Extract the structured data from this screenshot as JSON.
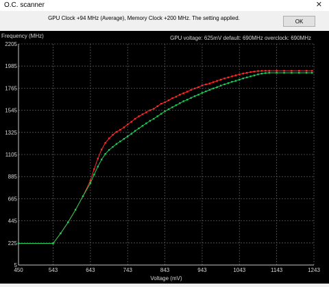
{
  "window": {
    "title": "O.C. scanner",
    "close_glyph": "✕"
  },
  "status_text": "GPU Clock +94 MHz (Average), Memory Clock +200 MHz. The setting applied.",
  "ok_label": "OK",
  "chart_data": {
    "type": "line",
    "ylabel": "Frequency (MHz)",
    "xlabel": "Voltage (mV)",
    "header_note": "GPU voltage: 625mV default: 690MHz overclock: 690MHz",
    "x_ticks": [
      450,
      543,
      643,
      743,
      843,
      943,
      1043,
      1143,
      1243
    ],
    "y_ticks": [
      5,
      225,
      445,
      665,
      885,
      1105,
      1325,
      1545,
      1765,
      1985,
      2205
    ],
    "xlim": [
      450,
      1243
    ],
    "ylim": [
      5,
      2205
    ],
    "grid": true,
    "colors": {
      "red": "#ff2a2a",
      "green": "#1cd05a",
      "grid": "#5a5a5a",
      "axis": "#c8c8c8",
      "text": "#d8d8d8"
    },
    "series": [
      {
        "color": "red",
        "points": [
          [
            450,
            220
          ],
          [
            543,
            220
          ],
          [
            563,
            320
          ],
          [
            583,
            430
          ],
          [
            603,
            555
          ],
          [
            623,
            690
          ],
          [
            643,
            845
          ],
          [
            653,
            960
          ],
          [
            663,
            1065
          ],
          [
            673,
            1155
          ],
          [
            683,
            1220
          ],
          [
            693,
            1265
          ],
          [
            703,
            1300
          ],
          [
            713,
            1330
          ],
          [
            723,
            1350
          ],
          [
            733,
            1375
          ],
          [
            743,
            1405
          ],
          [
            753,
            1430
          ],
          [
            763,
            1460
          ],
          [
            773,
            1485
          ],
          [
            783,
            1505
          ],
          [
            793,
            1525
          ],
          [
            803,
            1545
          ],
          [
            813,
            1560
          ],
          [
            823,
            1585
          ],
          [
            833,
            1610
          ],
          [
            843,
            1625
          ],
          [
            853,
            1645
          ],
          [
            863,
            1665
          ],
          [
            873,
            1680
          ],
          [
            883,
            1700
          ],
          [
            893,
            1715
          ],
          [
            903,
            1730
          ],
          [
            913,
            1748
          ],
          [
            923,
            1762
          ],
          [
            933,
            1775
          ],
          [
            943,
            1792
          ],
          [
            953,
            1802
          ],
          [
            963,
            1812
          ],
          [
            973,
            1825
          ],
          [
            983,
            1838
          ],
          [
            993,
            1850
          ],
          [
            1003,
            1862
          ],
          [
            1013,
            1872
          ],
          [
            1023,
            1882
          ],
          [
            1033,
            1893
          ],
          [
            1043,
            1902
          ],
          [
            1053,
            1910
          ],
          [
            1063,
            1918
          ],
          [
            1073,
            1925
          ],
          [
            1083,
            1930
          ],
          [
            1093,
            1935
          ],
          [
            1103,
            1937
          ],
          [
            1113,
            1938
          ],
          [
            1123,
            1938
          ],
          [
            1143,
            1938
          ],
          [
            1163,
            1938
          ],
          [
            1183,
            1938
          ],
          [
            1203,
            1938
          ],
          [
            1223,
            1938
          ],
          [
            1238,
            1938
          ]
        ]
      },
      {
        "color": "green",
        "points": [
          [
            450,
            220
          ],
          [
            543,
            220
          ],
          [
            563,
            320
          ],
          [
            583,
            430
          ],
          [
            603,
            555
          ],
          [
            623,
            690
          ],
          [
            643,
            820
          ],
          [
            653,
            905
          ],
          [
            663,
            985
          ],
          [
            673,
            1055
          ],
          [
            683,
            1110
          ],
          [
            693,
            1150
          ],
          [
            703,
            1180
          ],
          [
            713,
            1210
          ],
          [
            723,
            1235
          ],
          [
            733,
            1260
          ],
          [
            743,
            1285
          ],
          [
            753,
            1310
          ],
          [
            763,
            1340
          ],
          [
            773,
            1365
          ],
          [
            783,
            1390
          ],
          [
            793,
            1415
          ],
          [
            803,
            1440
          ],
          [
            813,
            1460
          ],
          [
            823,
            1485
          ],
          [
            833,
            1510
          ],
          [
            843,
            1535
          ],
          [
            853,
            1555
          ],
          [
            863,
            1575
          ],
          [
            873,
            1595
          ],
          [
            883,
            1615
          ],
          [
            893,
            1635
          ],
          [
            903,
            1650
          ],
          [
            913,
            1668
          ],
          [
            923,
            1685
          ],
          [
            933,
            1700
          ],
          [
            943,
            1718
          ],
          [
            953,
            1733
          ],
          [
            963,
            1748
          ],
          [
            973,
            1762
          ],
          [
            983,
            1775
          ],
          [
            993,
            1790
          ],
          [
            1003,
            1803
          ],
          [
            1013,
            1815
          ],
          [
            1023,
            1828
          ],
          [
            1033,
            1838
          ],
          [
            1043,
            1850
          ],
          [
            1053,
            1862
          ],
          [
            1063,
            1872
          ],
          [
            1073,
            1882
          ],
          [
            1083,
            1892
          ],
          [
            1093,
            1902
          ],
          [
            1103,
            1910
          ],
          [
            1113,
            1915
          ],
          [
            1123,
            1918
          ],
          [
            1143,
            1918
          ],
          [
            1163,
            1918
          ],
          [
            1183,
            1918
          ],
          [
            1203,
            1918
          ],
          [
            1223,
            1918
          ],
          [
            1238,
            1918
          ]
        ]
      }
    ]
  }
}
